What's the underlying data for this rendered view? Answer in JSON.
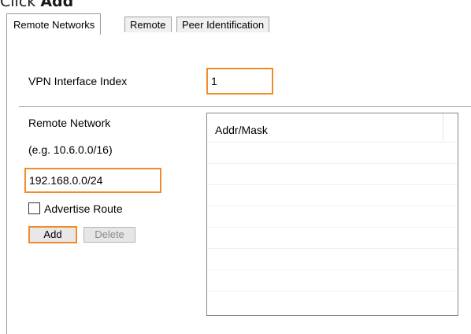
{
  "instruction": {
    "prefix": "Click ",
    "action": "Add"
  },
  "tabs": [
    {
      "label": "Remote Networks",
      "active": true
    },
    {
      "label": "Remote",
      "active": false
    },
    {
      "label": "Peer Identification",
      "active": false
    }
  ],
  "form": {
    "vpn_interface_index_label": "VPN Interface Index",
    "vpn_interface_index_value": "1",
    "remote_network_label": "Remote Network",
    "remote_network_hint": "(e.g. 10.6.0.0/16)",
    "remote_network_value": "192.168.0.0/24",
    "advertise_route_label": "Advertise Route",
    "advertise_route_checked": false,
    "add_label": "Add",
    "delete_label": "Delete"
  },
  "network_list": {
    "columns": [
      "Addr/Mask"
    ],
    "rows": []
  },
  "colors": {
    "highlight": "#f28c28",
    "border": "#999999"
  }
}
